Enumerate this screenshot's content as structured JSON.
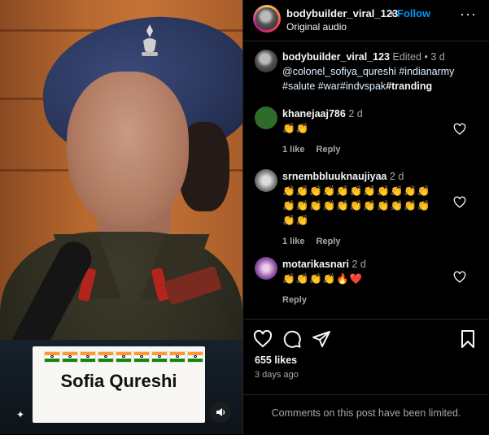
{
  "video": {
    "overlay_name": "Sofia Qureshi",
    "flag_emoji_count": 9
  },
  "post": {
    "username": "bodybuilder_viral_123",
    "separator": "•",
    "follow_label": "Follow",
    "audio": "Original audio",
    "more_label": "···"
  },
  "caption": {
    "username": "bodybuilder_viral_123",
    "edited": "Edited",
    "dot": "•",
    "time": "3 d",
    "mention": "@colonel_sofiya_qureshi",
    "tag1": "#indianarmy",
    "tag2": "#salute",
    "tag3": "#war",
    "tag4": "#indvspak",
    "tag5": "#tranding"
  },
  "comments": [
    {
      "username": "khanejaaj786",
      "time": "2 d",
      "text": "👏👏",
      "likes": "1 like",
      "reply": "Reply",
      "avatar_color": "#2f6b2a"
    },
    {
      "username": "srnembbluuknaujiyaa",
      "time": "2 d",
      "text_line1": "👏👏👏👏👏👏👏👏👏👏👏",
      "text_line2": "👏👏👏👏👏👏👏👏👏👏👏",
      "text_line3": "👏👏",
      "likes": "1 like",
      "reply": "Reply",
      "avatar_color": "#7a7a7a"
    },
    {
      "username": "motarikasnari",
      "time": "2 d",
      "text": "👏👏👏👏🔥",
      "heart": "❤️",
      "reply": "Reply",
      "avatar_color": "#8a4fa3"
    }
  ],
  "actions": {
    "likes": "655 likes",
    "ago": "3 days ago",
    "limited": "Comments on this post have been limited."
  },
  "colors": {
    "accent": "#0095f6",
    "background": "#000000",
    "muted": "#a8a8a8"
  }
}
